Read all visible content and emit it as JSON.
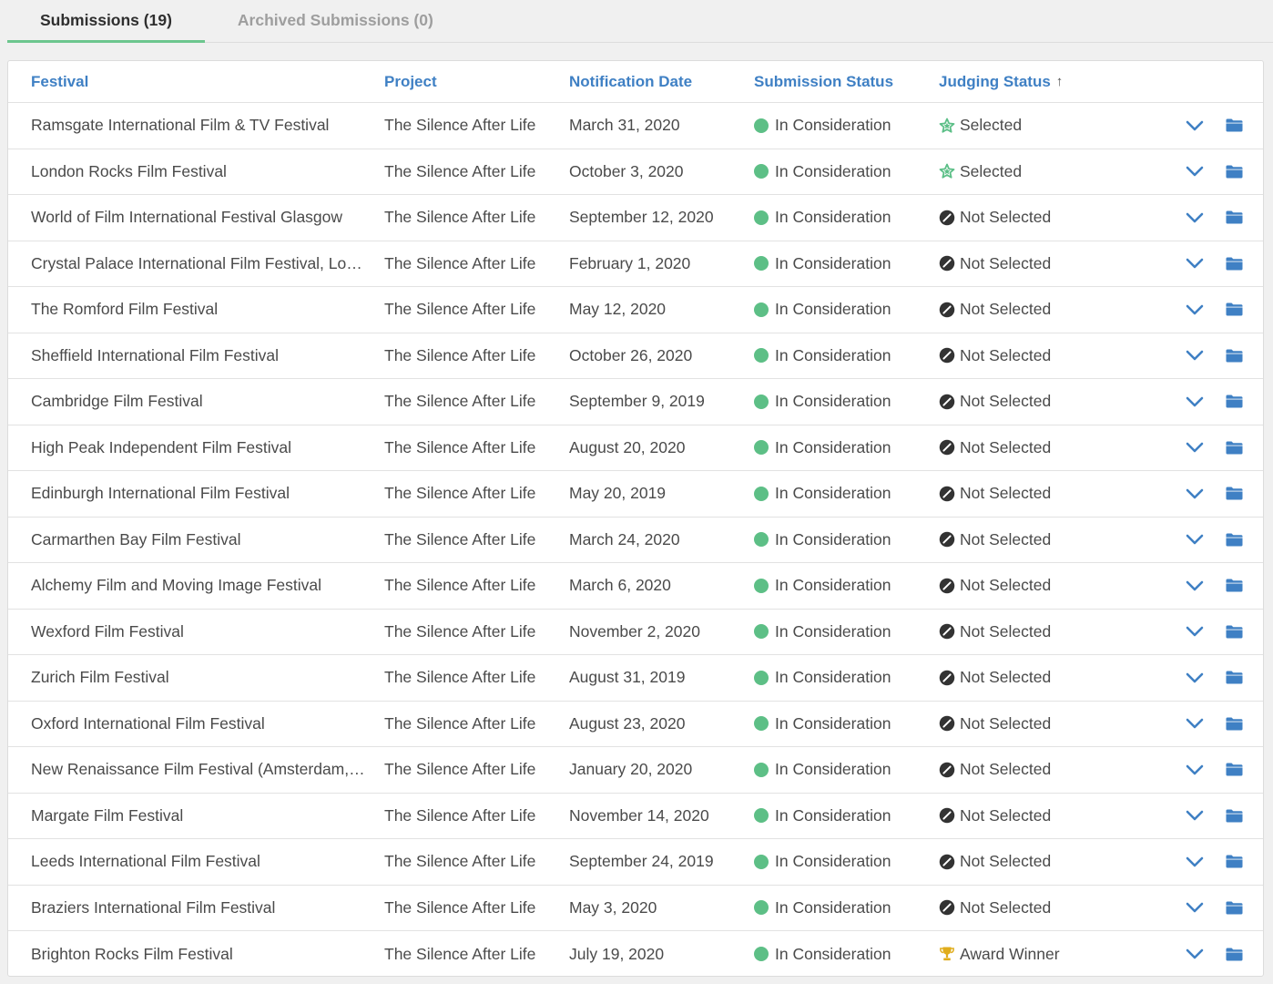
{
  "tabs": [
    {
      "label": "Submissions (19)",
      "active": true
    },
    {
      "label": "Archived Submissions (0)",
      "active": false
    }
  ],
  "table": {
    "columns": [
      "Festival",
      "Project",
      "Notification Date",
      "Submission Status",
      "Judging Status"
    ],
    "sort_indicator": "↑",
    "rows": [
      {
        "festival": "Ramsgate International Film & TV Festival",
        "project": "The Silence After Life",
        "date": "March 31, 2020",
        "submission_status": "In Consideration",
        "judging_status": "Selected",
        "judging_icon": "star-icon"
      },
      {
        "festival": "London Rocks Film Festival",
        "project": "The Silence After Life",
        "date": "October 3, 2020",
        "submission_status": "In Consideration",
        "judging_status": "Selected",
        "judging_icon": "star-icon"
      },
      {
        "festival": "World of Film International Festival Glasgow",
        "project": "The Silence After Life",
        "date": "September 12, 2020",
        "submission_status": "In Consideration",
        "judging_status": "Not Selected",
        "judging_icon": "not-selected-icon"
      },
      {
        "festival": "Crystal Palace International Film Festival, London",
        "project": "The Silence After Life",
        "date": "February 1, 2020",
        "submission_status": "In Consideration",
        "judging_status": "Not Selected",
        "judging_icon": "not-selected-icon"
      },
      {
        "festival": "The Romford Film Festival",
        "project": "The Silence After Life",
        "date": "May 12, 2020",
        "submission_status": "In Consideration",
        "judging_status": "Not Selected",
        "judging_icon": "not-selected-icon"
      },
      {
        "festival": "Sheffield International Film Festival",
        "project": "The Silence After Life",
        "date": "October 26, 2020",
        "submission_status": "In Consideration",
        "judging_status": "Not Selected",
        "judging_icon": "not-selected-icon"
      },
      {
        "festival": "Cambridge Film Festival",
        "project": "The Silence After Life",
        "date": "September 9, 2019",
        "submission_status": "In Consideration",
        "judging_status": "Not Selected",
        "judging_icon": "not-selected-icon"
      },
      {
        "festival": "High Peak Independent Film Festival",
        "project": "The Silence After Life",
        "date": "August 20, 2020",
        "submission_status": "In Consideration",
        "judging_status": "Not Selected",
        "judging_icon": "not-selected-icon"
      },
      {
        "festival": "Edinburgh International Film Festival",
        "project": "The Silence After Life",
        "date": "May 20, 2019",
        "submission_status": "In Consideration",
        "judging_status": "Not Selected",
        "judging_icon": "not-selected-icon"
      },
      {
        "festival": "Carmarthen Bay Film Festival",
        "project": "The Silence After Life",
        "date": "March 24, 2020",
        "submission_status": "In Consideration",
        "judging_status": "Not Selected",
        "judging_icon": "not-selected-icon"
      },
      {
        "festival": "Alchemy Film and Moving Image Festival",
        "project": "The Silence After Life",
        "date": "March 6, 2020",
        "submission_status": "In Consideration",
        "judging_status": "Not Selected",
        "judging_icon": "not-selected-icon"
      },
      {
        "festival": "Wexford Film Festival",
        "project": "The Silence After Life",
        "date": "November 2, 2020",
        "submission_status": "In Consideration",
        "judging_status": "Not Selected",
        "judging_icon": "not-selected-icon"
      },
      {
        "festival": "Zurich Film Festival",
        "project": "The Silence After Life",
        "date": "August 31, 2019",
        "submission_status": "In Consideration",
        "judging_status": "Not Selected",
        "judging_icon": "not-selected-icon"
      },
      {
        "festival": "Oxford International Film Festival",
        "project": "The Silence After Life",
        "date": "August 23, 2020",
        "submission_status": "In Consideration",
        "judging_status": "Not Selected",
        "judging_icon": "not-selected-icon"
      },
      {
        "festival": "New Renaissance Film Festival (Amsterdam, ...",
        "project": "The Silence After Life",
        "date": "January 20, 2020",
        "submission_status": "In Consideration",
        "judging_status": "Not Selected",
        "judging_icon": "not-selected-icon"
      },
      {
        "festival": "Margate Film Festival",
        "project": "The Silence After Life",
        "date": "November 14, 2020",
        "submission_status": "In Consideration",
        "judging_status": "Not Selected",
        "judging_icon": "not-selected-icon"
      },
      {
        "festival": "Leeds International Film Festival",
        "project": "The Silence After Life",
        "date": "September 24, 2019",
        "submission_status": "In Consideration",
        "judging_status": "Not Selected",
        "judging_icon": "not-selected-icon"
      },
      {
        "festival": "Braziers International Film Festival",
        "project": "The Silence After Life",
        "date": "May 3, 2020",
        "submission_status": "In Consideration",
        "judging_status": "Not Selected",
        "judging_icon": "not-selected-icon"
      },
      {
        "festival": "Brighton Rocks Film Festival",
        "project": "The Silence After Life",
        "date": "July 19, 2020",
        "submission_status": "In Consideration",
        "judging_status": "Award Winner",
        "judging_icon": "trophy-icon"
      }
    ]
  },
  "colors": {
    "accent_blue": "#3f80c4",
    "tab_underline": "#6cc68e",
    "status_green": "#5dbf86",
    "selected_star": "#5cbf87",
    "trophy_gold": "#e0ad1c"
  }
}
